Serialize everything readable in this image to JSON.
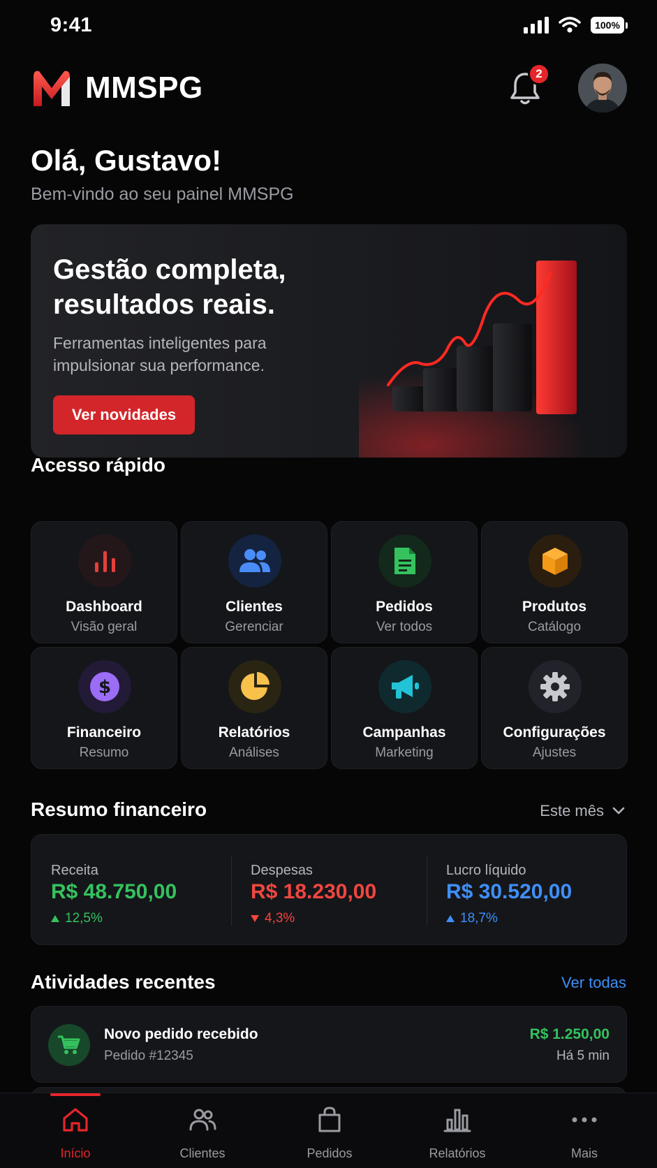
{
  "status_bar": {
    "time": "9:41",
    "battery": "100%"
  },
  "header": {
    "brand": "MMSPG",
    "notifications_count": "2"
  },
  "greeting": {
    "title": "Olá, Gustavo!",
    "subtitle": "Bem-vindo ao seu painel MMSPG"
  },
  "hero": {
    "title": "Gestão completa, resultados reais.",
    "text": "Ferramentas inteligentes para impulsionar sua performance.",
    "button": "Ver novidades"
  },
  "quick_access": {
    "title": "Acesso rápido",
    "items": [
      {
        "label": "Dashboard",
        "sub": "Visão geral",
        "icon": "bar-chart-icon",
        "color": "#e5403a"
      },
      {
        "label": "Clientes",
        "sub": "Gerenciar",
        "icon": "users-icon",
        "color": "#4a8df8"
      },
      {
        "label": "Pedidos",
        "sub": "Ver todos",
        "icon": "document-icon",
        "color": "#35c25e"
      },
      {
        "label": "Produtos",
        "sub": "Catálogo",
        "icon": "box-icon",
        "color": "#f59a17"
      },
      {
        "label": "Financeiro",
        "sub": "Resumo",
        "icon": "dollar-icon",
        "color": "#9b6cf6"
      },
      {
        "label": "Relatórios",
        "sub": "Análises",
        "icon": "pie-chart-icon",
        "color": "#f7c14a"
      },
      {
        "label": "Campanhas",
        "sub": "Marketing",
        "icon": "megaphone-icon",
        "color": "#22c3d6"
      },
      {
        "label": "Configurações",
        "sub": "Ajustes",
        "icon": "gear-icon",
        "color": "#c7c9ce"
      }
    ]
  },
  "finance": {
    "title": "Resumo financeiro",
    "period": "Este mês",
    "metrics": [
      {
        "label": "Receita",
        "value": "R$ 48.750,00",
        "delta": "12,5%",
        "trend": "up",
        "color": "#35c25e"
      },
      {
        "label": "Despesas",
        "value": "R$ 18.230,00",
        "delta": "4,3%",
        "trend": "down",
        "color": "#f0463f"
      },
      {
        "label": "Lucro líquido",
        "value": "R$ 30.520,00",
        "delta": "18,7%",
        "trend": "up",
        "color": "#3f8ff7"
      }
    ]
  },
  "activities": {
    "title": "Atividades recentes",
    "see_all": "Ver todas",
    "items": [
      {
        "title": "Novo pedido recebido",
        "sub": "Pedido #12345",
        "amount": "R$ 1.250,00",
        "time": "Há 5 min",
        "icon": "cart-icon"
      }
    ]
  },
  "tabbar": {
    "items": [
      {
        "label": "Início",
        "icon": "home-icon",
        "active": true
      },
      {
        "label": "Clientes",
        "icon": "users-icon",
        "active": false
      },
      {
        "label": "Pedidos",
        "icon": "bag-icon",
        "active": false
      },
      {
        "label": "Relatórios",
        "icon": "bar-chart-icon",
        "active": false
      },
      {
        "label": "Mais",
        "icon": "more-icon",
        "active": false
      }
    ]
  }
}
